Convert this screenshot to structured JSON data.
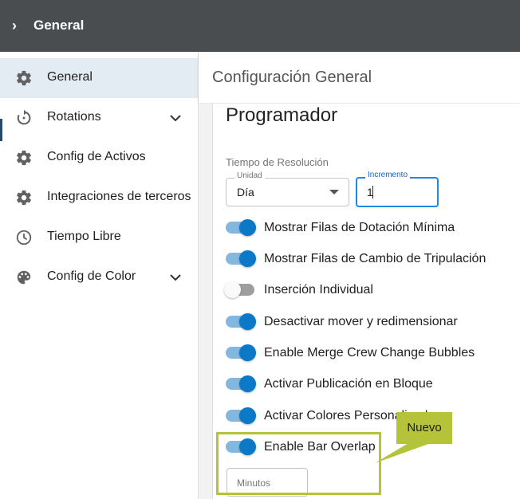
{
  "topbar": {
    "title": "General"
  },
  "sidebar": {
    "items": [
      {
        "label": "General",
        "icon": "gear-icon",
        "active": true,
        "expandable": false
      },
      {
        "label": "Rotations",
        "icon": "rotation-icon",
        "active": false,
        "expandable": true
      },
      {
        "label": "Config de Activos",
        "icon": "gear-icon",
        "active": false,
        "expandable": false
      },
      {
        "label": "Integraciones de terceros",
        "icon": "gear-icon",
        "active": false,
        "expandable": false
      },
      {
        "label": "Tiempo Libre",
        "icon": "clock-icon",
        "active": false,
        "expandable": false
      },
      {
        "label": "Config de Color",
        "icon": "palette-icon",
        "active": false,
        "expandable": true
      }
    ]
  },
  "header": {
    "title": "Configuración General"
  },
  "section": {
    "title": "Programador",
    "resolution": {
      "label": "Tiempo de Resolución",
      "unit_label": "Unidad",
      "unit_value": "Día",
      "increment_label": "Incremento",
      "increment_value": "1"
    },
    "toggles": [
      {
        "label": "Mostrar Filas de Dotación Mínima",
        "on": true
      },
      {
        "label": "Mostrar Filas de Cambio de Tripulación",
        "on": true
      },
      {
        "label": "Inserción Individual",
        "on": false
      },
      {
        "label": "Desactivar mover y redimensionar",
        "on": true
      },
      {
        "label": "Enable Merge Crew Change Bubbles",
        "on": true
      },
      {
        "label": "Activar Publicación en Bloque",
        "on": true
      },
      {
        "label": "Activar Colores Personalizados",
        "on": true
      },
      {
        "label": "Enable Bar Overlap",
        "on": true
      }
    ],
    "minutes_placeholder": "Minutos"
  },
  "annotation": {
    "label": "Nuevo",
    "color": "#b5c33b"
  },
  "colors": {
    "topbar": "#4a4d50",
    "accent": "#0b78c8",
    "active_nav": "#e3ebf3"
  }
}
